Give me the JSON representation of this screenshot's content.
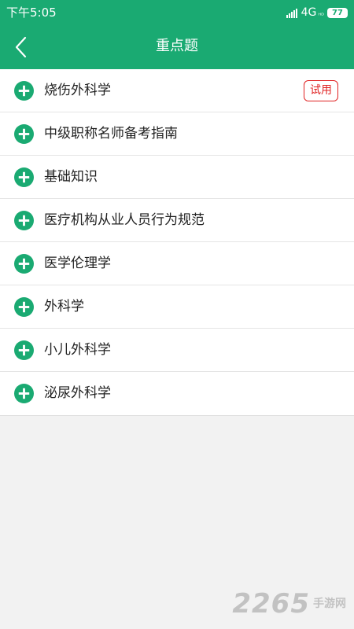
{
  "status_bar": {
    "time": "下午5:05",
    "network": "4G",
    "network_sub": "ᴴᴰ",
    "battery": "77"
  },
  "header": {
    "title": "重点题"
  },
  "list": {
    "items": [
      {
        "label": "烧伤外科学",
        "badge": "试用"
      },
      {
        "label": "中级职称名师备考指南"
      },
      {
        "label": "基础知识"
      },
      {
        "label": "医疗机构从业人员行为规范"
      },
      {
        "label": "医学伦理学"
      },
      {
        "label": "外科学"
      },
      {
        "label": "小儿外科学"
      },
      {
        "label": "泌尿外科学"
      }
    ]
  },
  "watermark": {
    "number": "2265",
    "text": "手游网"
  },
  "colors": {
    "brand": "#1aaa72",
    "badge": "#e02222"
  },
  "icons": {
    "back": "back-arrow-icon",
    "expand": "plus-circle-icon",
    "signal": "signal-icon",
    "battery": "battery-icon"
  }
}
